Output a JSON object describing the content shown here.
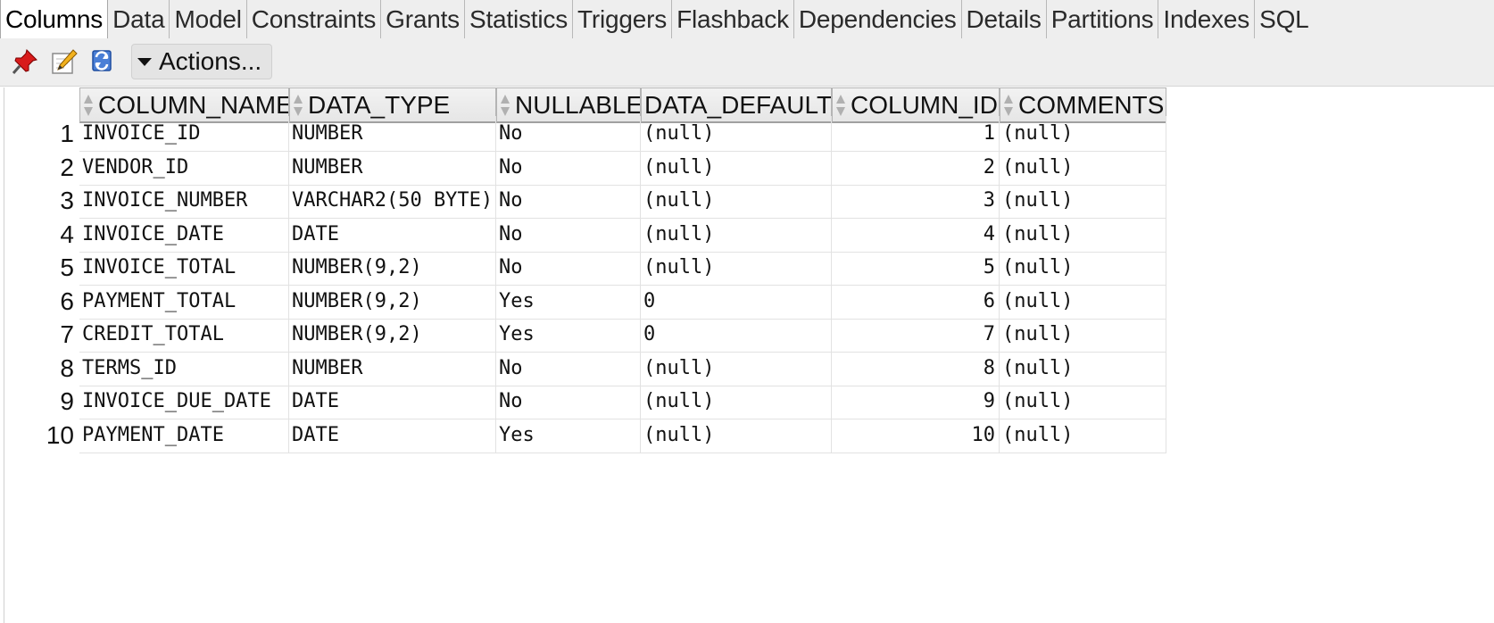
{
  "tabs": [
    "Columns",
    "Data",
    "Model",
    "Constraints",
    "Grants",
    "Statistics",
    "Triggers",
    "Flashback",
    "Dependencies",
    "Details",
    "Partitions",
    "Indexes",
    "SQL"
  ],
  "active_tab": "Columns",
  "toolbar": {
    "actions_label": "Actions..."
  },
  "table": {
    "headers": [
      "COLUMN_NAME",
      "DATA_TYPE",
      "NULLABLE",
      "DATA_DEFAULT",
      "COLUMN_ID",
      "COMMENTS"
    ],
    "rows": [
      {
        "n": "1",
        "name": "INVOICE_ID",
        "type": "NUMBER",
        "nullable": "No",
        "default": "(null)",
        "id": "1",
        "comments": "(null)"
      },
      {
        "n": "2",
        "name": "VENDOR_ID",
        "type": "NUMBER",
        "nullable": "No",
        "default": "(null)",
        "id": "2",
        "comments": "(null)"
      },
      {
        "n": "3",
        "name": "INVOICE_NUMBER",
        "type": "VARCHAR2(50 BYTE)",
        "nullable": "No",
        "default": "(null)",
        "id": "3",
        "comments": "(null)"
      },
      {
        "n": "4",
        "name": "INVOICE_DATE",
        "type": "DATE",
        "nullable": "No",
        "default": "(null)",
        "id": "4",
        "comments": "(null)"
      },
      {
        "n": "5",
        "name": "INVOICE_TOTAL",
        "type": "NUMBER(9,2)",
        "nullable": "No",
        "default": "(null)",
        "id": "5",
        "comments": "(null)"
      },
      {
        "n": "6",
        "name": "PAYMENT_TOTAL",
        "type": "NUMBER(9,2)",
        "nullable": "Yes",
        "default": "0",
        "id": "6",
        "comments": "(null)"
      },
      {
        "n": "7",
        "name": "CREDIT_TOTAL",
        "type": "NUMBER(9,2)",
        "nullable": "Yes",
        "default": "0",
        "id": "7",
        "comments": "(null)"
      },
      {
        "n": "8",
        "name": "TERMS_ID",
        "type": "NUMBER",
        "nullable": "No",
        "default": "(null)",
        "id": "8",
        "comments": "(null)"
      },
      {
        "n": "9",
        "name": "INVOICE_DUE_DATE",
        "type": "DATE",
        "nullable": "No",
        "default": "(null)",
        "id": "9",
        "comments": "(null)"
      },
      {
        "n": "10",
        "name": "PAYMENT_DATE",
        "type": "DATE",
        "nullable": "Yes",
        "default": "(null)",
        "id": "10",
        "comments": "(null)"
      }
    ]
  },
  "icons": [
    "pin-icon",
    "edit-icon",
    "refresh-icon",
    "actions-dropdown-icon"
  ]
}
